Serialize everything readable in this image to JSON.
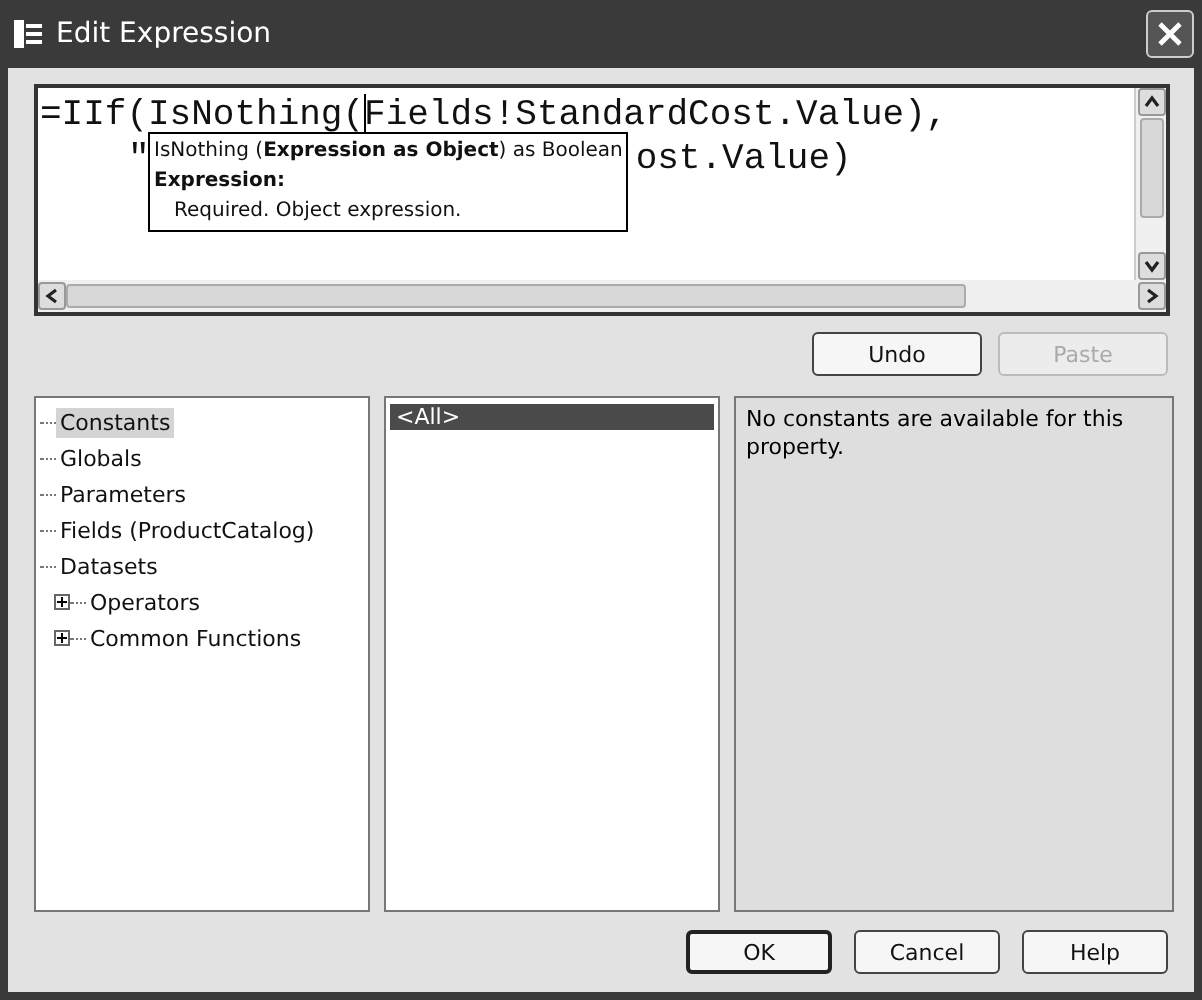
{
  "window": {
    "title": "Edit Expression"
  },
  "editor": {
    "line_1": "=IIf(IsNothing(Fields!StandardCost.Value),",
    "line_2_start": "\"",
    "line_2_end": "ost.Value)"
  },
  "tooltip": {
    "signature": "IsNothing (**Expression as Object**) as Boolean",
    "param_label": "Expression:",
    "param_description": "Required. Object expression."
  },
  "edit_buttons": [
    {
      "label": "Undo",
      "disabled": false
    },
    {
      "label": "Paste",
      "disabled": true
    }
  ],
  "categories": [
    {
      "label": "Constants",
      "selected": true,
      "expandable": false
    },
    {
      "label": "Globals",
      "selected": false,
      "expandable": false
    },
    {
      "label": "Parameters",
      "selected": false,
      "expandable": false
    },
    {
      "label": "Fields (ProductCatalog)",
      "selected": false,
      "expandable": false
    },
    {
      "label": "Datasets",
      "selected": false,
      "expandable": false
    },
    {
      "label": "Operators",
      "selected": false,
      "expandable": true
    },
    {
      "label": "Common Functions",
      "selected": false,
      "expandable": true
    }
  ],
  "items": [
    {
      "label": "<All>",
      "selected": true
    }
  ],
  "description": "No constants are available for this property.",
  "dialog_buttons": [
    {
      "label": "OK",
      "default": true
    },
    {
      "label": "Cancel",
      "default": false
    },
    {
      "label": "Help",
      "default": false
    }
  ]
}
